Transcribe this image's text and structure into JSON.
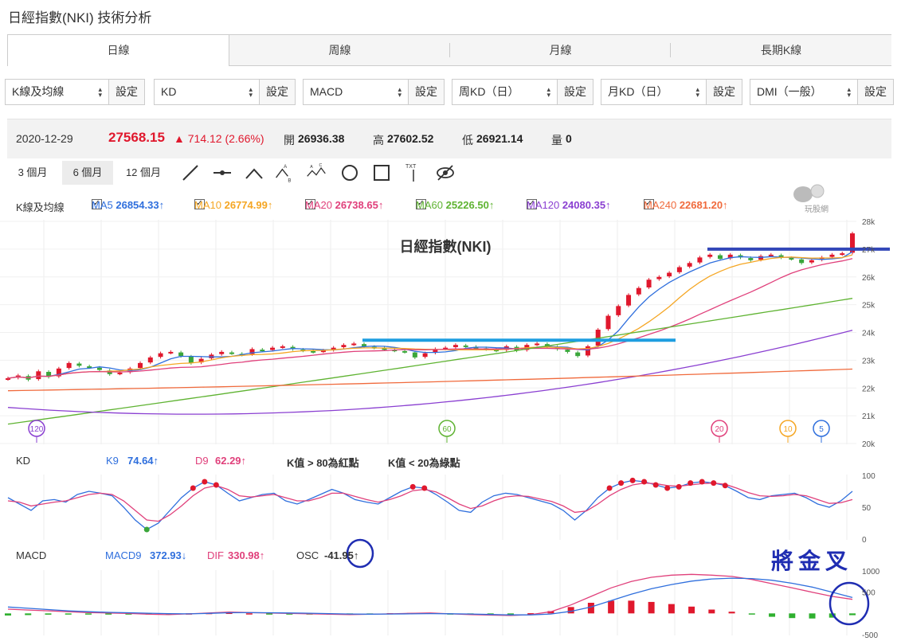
{
  "page_title": "日經指數(NKI) 技術分析",
  "tabs": [
    {
      "label": "日線",
      "active": true
    },
    {
      "label": "周線",
      "active": false
    },
    {
      "label": "月線",
      "active": false
    },
    {
      "label": "長期K線",
      "active": false
    }
  ],
  "selectors": [
    {
      "value": "K線及均線",
      "button": "設定"
    },
    {
      "value": "KD",
      "button": "設定"
    },
    {
      "value": "MACD",
      "button": "設定"
    },
    {
      "value": "周KD（日）",
      "button": "設定"
    },
    {
      "value": "月KD（日）",
      "button": "設定"
    },
    {
      "value": "DMI（一般）",
      "button": "設定"
    }
  ],
  "quote": {
    "date": "2020-12-29",
    "price": "27568.15",
    "change": "▲ 714.12 (2.66%)",
    "open_label": "開",
    "open": "26936.38",
    "high_label": "高",
    "high": "27602.52",
    "low_label": "低",
    "low": "26921.14",
    "vol_label": "量",
    "vol": "0"
  },
  "ranges": [
    {
      "label": "3 個月",
      "active": false
    },
    {
      "label": "6 個月",
      "active": true
    },
    {
      "label": "12 個月",
      "active": false
    }
  ],
  "tools": [
    "line-tool-icon",
    "horizontal-line-tool-icon",
    "angle-tool-icon",
    "abc-pattern-tool-icon",
    "abcd-pattern-tool-icon",
    "circle-tool-icon",
    "rectangle-tool-icon",
    "text-tool-icon",
    "hide-drawings-icon"
  ],
  "tool_texts": {
    "abc_a": "A",
    "abc_b": "B",
    "abc_c": "C",
    "txt": "TXT"
  },
  "logo_text": "玩股網",
  "ma": {
    "label": "K線及均線",
    "items": [
      {
        "name": "MA5",
        "value": "26854.33↑",
        "color": "#2f6fdd"
      },
      {
        "name": "MA10",
        "value": "26774.99↑",
        "color": "#f5a623"
      },
      {
        "name": "MA20",
        "value": "26738.65↑",
        "color": "#e0407b"
      },
      {
        "name": "MA60",
        "value": "25226.50↑",
        "color": "#5fb332"
      },
      {
        "name": "MA120",
        "value": "24080.35↑",
        "color": "#8a3fd1"
      },
      {
        "name": "MA240",
        "value": "22681.20↑",
        "color": "#f06a3c"
      }
    ]
  },
  "main_chart": {
    "title": "日經指數(NKI)",
    "y_ticks": [
      "28k",
      "27k",
      "26k",
      "25k",
      "24k",
      "23k",
      "22k",
      "21k",
      "20k"
    ],
    "ma_markers": [
      {
        "label": "120",
        "color": "#8a3fd1"
      },
      {
        "label": "60",
        "color": "#5fb332"
      },
      {
        "label": "20",
        "color": "#e0407b"
      },
      {
        "label": "10",
        "color": "#f5a623"
      },
      {
        "label": "5",
        "color": "#2f6fdd"
      }
    ]
  },
  "kd": {
    "label": "KD",
    "k": {
      "name": "K9",
      "value": "74.64↑",
      "color": "#2f6fdd"
    },
    "d": {
      "name": "D9",
      "value": "62.29↑",
      "color": "#e0407b"
    },
    "note1": "K值 > 80為紅點",
    "note2": "K值 < 20為綠點",
    "y_ticks": [
      "100",
      "50",
      "0"
    ]
  },
  "macd": {
    "label": "MACD",
    "macd9": {
      "name": "MACD9",
      "value": "372.93↓",
      "color": "#2f6fdd"
    },
    "dif": {
      "name": "DIF",
      "value": "330.98↑",
      "color": "#e0407b"
    },
    "osc": {
      "name": "OSC",
      "value": "-41.95↑",
      "color": "#333333"
    },
    "y_ticks": [
      "1000",
      "500",
      "-500"
    ]
  },
  "annotation": {
    "handwritten": "將金叉",
    "color": "#1f2db2"
  },
  "chart_data": [
    {
      "type": "line",
      "title": "日經指數(NKI)",
      "ylim": [
        20000,
        28000
      ],
      "y_ticks": [
        28000,
        27000,
        26000,
        25000,
        24000,
        23000,
        22000,
        21000,
        20000
      ],
      "close": [
        22350,
        22450,
        22300,
        22600,
        22400,
        22700,
        22900,
        22800,
        22750,
        22650,
        22500,
        22550,
        22700,
        22900,
        23100,
        23250,
        23300,
        23150,
        22900,
        23050,
        23200,
        23300,
        23250,
        23200,
        23400,
        23350,
        23450,
        23500,
        23400,
        23350,
        23300,
        23350,
        23450,
        23550,
        23600,
        23500,
        23450,
        23400,
        23350,
        23300,
        23100,
        23250,
        23400,
        23450,
        23550,
        23500,
        23450,
        23400,
        23350,
        23500,
        23350,
        23550,
        23600,
        23500,
        23400,
        23300,
        23150,
        23500,
        24100,
        24600,
        24950,
        25350,
        25600,
        25900,
        26000,
        26150,
        26350,
        26500,
        26700,
        26800,
        26650,
        26800,
        26700,
        26600,
        26750,
        26800,
        26700,
        26650,
        26500,
        26600,
        26700,
        26800,
        26850,
        27568
      ],
      "series": [
        {
          "name": "MA5",
          "end": 26854.33
        },
        {
          "name": "MA10",
          "end": 26774.99
        },
        {
          "name": "MA20",
          "end": 26738.65
        },
        {
          "name": "MA60",
          "end": 25226.5
        },
        {
          "name": "MA120",
          "end": 24080.35
        },
        {
          "name": "MA240",
          "end": 22681.2
        }
      ]
    },
    {
      "type": "line",
      "title": "KD",
      "ylim": [
        0,
        100
      ],
      "series": [
        {
          "name": "K9",
          "values": [
            65,
            55,
            45,
            60,
            62,
            58,
            70,
            75,
            72,
            68,
            50,
            30,
            15,
            25,
            45,
            65,
            80,
            90,
            85,
            72,
            60,
            65,
            70,
            72,
            60,
            55,
            62,
            70,
            78,
            72,
            62,
            58,
            55,
            65,
            75,
            82,
            80,
            70,
            58,
            45,
            42,
            58,
            68,
            72,
            70,
            65,
            60,
            55,
            45,
            30,
            45,
            65,
            80,
            88,
            92,
            90,
            85,
            80,
            82,
            88,
            90,
            88,
            84,
            75,
            65,
            62,
            68,
            70,
            72,
            65,
            55,
            50,
            60,
            75
          ]
        },
        {
          "name": "D9",
          "values": [
            60,
            58,
            52,
            55,
            58,
            60,
            65,
            70,
            72,
            70,
            60,
            45,
            30,
            28,
            38,
            52,
            68,
            80,
            84,
            78,
            68,
            66,
            68,
            70,
            65,
            60,
            60,
            65,
            72,
            72,
            67,
            62,
            58,
            62,
            68,
            76,
            78,
            74,
            65,
            55,
            48,
            52,
            60,
            66,
            68,
            67,
            63,
            59,
            52,
            42,
            44,
            55,
            68,
            78,
            85,
            88,
            87,
            84,
            83,
            85,
            87,
            88,
            86,
            80,
            73,
            68,
            67,
            68,
            70,
            68,
            62,
            56,
            57,
            62
          ]
        }
      ]
    },
    {
      "type": "bar",
      "title": "MACD",
      "ylim": [
        -500,
        1000
      ],
      "series": [
        {
          "name": "DIF",
          "values": [
            100,
            80,
            60,
            40,
            20,
            10,
            0,
            -20,
            -30,
            -10,
            10,
            30,
            20,
            10,
            0,
            -10,
            -20,
            -30,
            -20,
            -10,
            0,
            10,
            -10,
            -30,
            -40,
            -50,
            -30,
            40,
            200,
            400,
            600,
            750,
            850,
            900,
            920,
            900,
            870,
            800,
            700,
            600,
            500,
            400,
            331
          ]
        },
        {
          "name": "MACD9",
          "values": [
            150,
            120,
            90,
            60,
            40,
            25,
            15,
            5,
            -5,
            -10,
            0,
            15,
            18,
            15,
            10,
            5,
            -5,
            -15,
            -18,
            -15,
            -10,
            -5,
            -8,
            -15,
            -25,
            -35,
            -35,
            -15,
            50,
            150,
            300,
            450,
            580,
            680,
            760,
            810,
            830,
            820,
            780,
            710,
            620,
            500,
            373
          ]
        },
        {
          "name": "OSC",
          "values": [
            -50,
            -40,
            -30,
            -20,
            -20,
            -15,
            -15,
            -25,
            -25,
            0,
            10,
            15,
            2,
            -5,
            -10,
            -15,
            -15,
            -15,
            -2,
            5,
            10,
            15,
            -2,
            -15,
            -15,
            -15,
            5,
            55,
            150,
            250,
            300,
            300,
            270,
            220,
            160,
            90,
            40,
            -20,
            -80,
            -110,
            -120,
            -100,
            -42
          ]
        }
      ]
    }
  ]
}
